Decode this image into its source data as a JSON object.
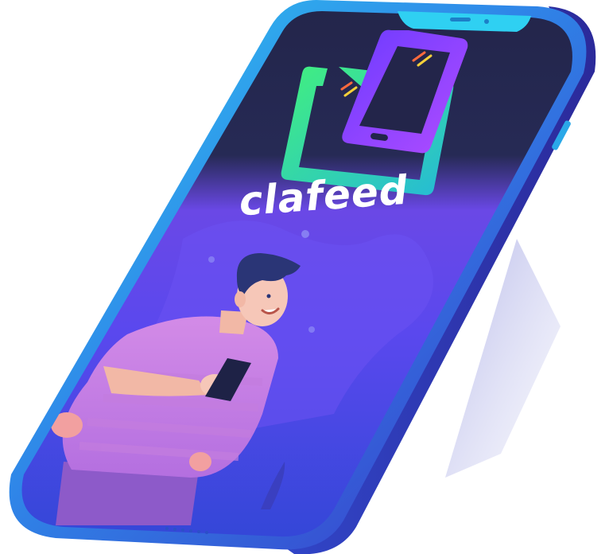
{
  "brand": {
    "name": "clafeed"
  },
  "colors": {
    "frame_light": "#36c6ef",
    "frame_dark": "#3a34c9",
    "screen_top": "#24264a",
    "screen_purple": "#7a4ff0",
    "screen_bottom": "#3a4fd8",
    "logo_green": "#3de38f",
    "logo_purple": "#8a48ff",
    "shirt_pink": "#d58ae6",
    "hair": "#2a3576",
    "skin": "#f6c7b8"
  },
  "icons": {
    "logo": "phone-tablet-logo-icon",
    "illustration": "man-holding-phone-illustration"
  }
}
